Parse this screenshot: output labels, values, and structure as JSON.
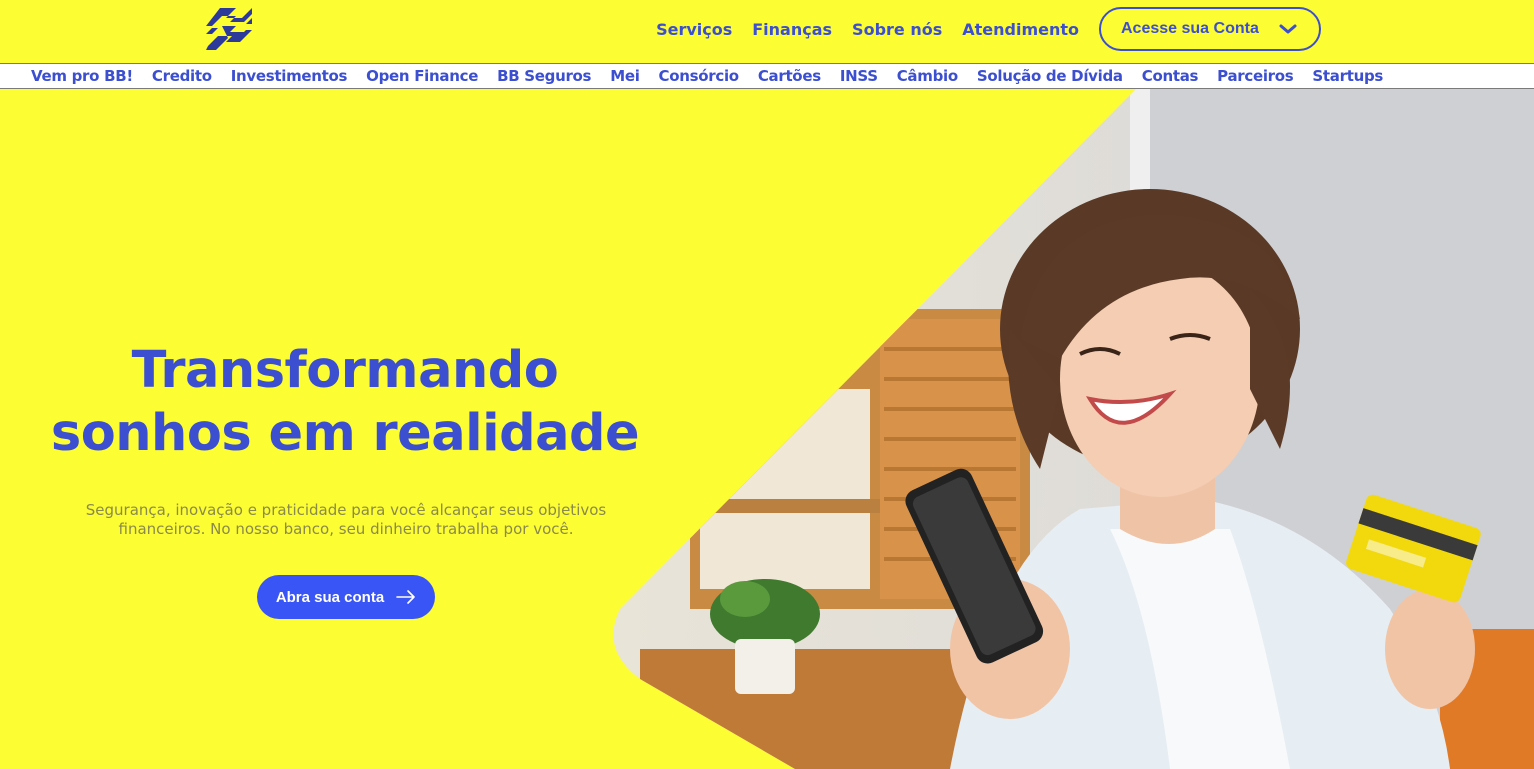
{
  "header": {
    "logo_icon": "bb-logo-icon",
    "nav": [
      "Serviços",
      "Finanças",
      "Sobre nós",
      "Atendimento"
    ],
    "account_button": {
      "label": "Acesse sua Conta",
      "icon": "chevron-down-icon"
    }
  },
  "subnav": {
    "items": [
      "Vem pro BB!",
      "Credito",
      "Investimentos",
      "Open Finance",
      "BB Seguros",
      "Mei",
      "Consórcio",
      "Cartões",
      "INSS",
      "Câmbio",
      "Solução de Dívida",
      "Contas",
      "Parceiros",
      "Startups"
    ]
  },
  "hero": {
    "title_line1": "Transformando",
    "title_line2": "sonhos em realidade",
    "subtitle_line1": "Segurança, inovação e praticidade para você alcançar seus objetivos",
    "subtitle_line2": "financeiros. No nosso banco, seu dinheiro trabalha por você.",
    "cta_label": "Abra sua conta",
    "cta_icon": "arrow-right-icon"
  },
  "colors": {
    "background_yellow": "#fdfd33",
    "brand_blue": "#3b4fd0",
    "cta_blue": "#3a55f5"
  }
}
